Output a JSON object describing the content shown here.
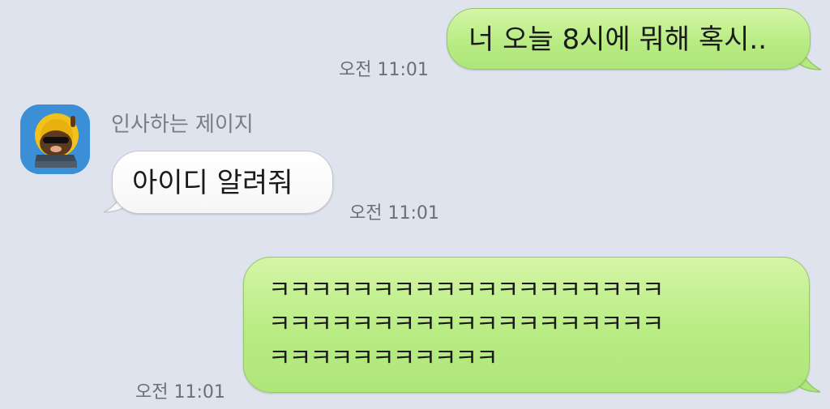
{
  "messages": [
    {
      "direction": "outgoing",
      "text": "너 오늘 8시에 뭐해 혹시..",
      "time": "오전 11:01"
    },
    {
      "direction": "incoming",
      "sender": "인사하는 제이지",
      "avatar_icon": "jay-g-character-avatar",
      "text": "아이디 알려줘",
      "time": "오전 11:01"
    },
    {
      "direction": "outgoing",
      "lines": [
        "ㅋㅋㅋㅋㅋㅋㅋㅋㅋㅋㅋㅋㅋㅋㅋㅋㅋㅋㅋ",
        "ㅋㅋㅋㅋㅋㅋㅋㅋㅋㅋㅋㅋㅋㅋㅋㅋㅋㅋㅋ",
        "ㅋㅋㅋㅋㅋㅋㅋㅋㅋㅋㅋ"
      ],
      "time": "오전 11:01"
    }
  ],
  "colors": {
    "background": "#dfe3ee",
    "outgoing_bubble": "#b9ec84",
    "incoming_bubble": "#ffffff",
    "avatar_bg": "#3a8fd6",
    "time_text": "#6b6f78"
  }
}
